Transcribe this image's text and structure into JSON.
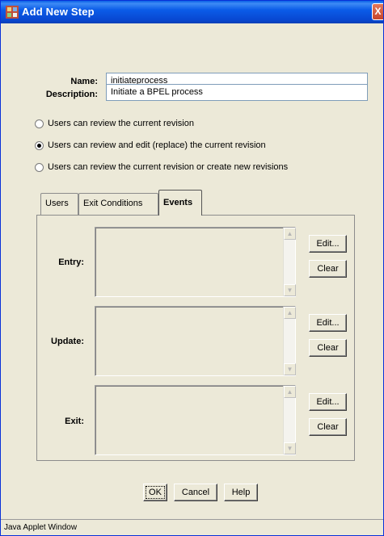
{
  "window": {
    "title": "Add New Step",
    "close_glyph": "X",
    "icon": "app-icon"
  },
  "form": {
    "name_label": "Name:",
    "name_value": "initiateprocess",
    "description_label": "Description:",
    "description_value": "Initiate a BPEL process"
  },
  "revision_options": [
    {
      "label": "Users can review the current revision",
      "selected": false
    },
    {
      "label": "Users can review and edit (replace) the current revision",
      "selected": true
    },
    {
      "label": "Users can review the current revision or create new revisions",
      "selected": false
    }
  ],
  "tabs": [
    {
      "label": "Users",
      "active": false
    },
    {
      "label": "Exit Conditions",
      "active": false
    },
    {
      "label": "Events",
      "active": true
    }
  ],
  "events": {
    "entry_label": "Entry:",
    "update_label": "Update:",
    "exit_label": "Exit:",
    "edit_label": "Edit...",
    "clear_label": "Clear"
  },
  "footer": {
    "ok_label": "OK",
    "cancel_label": "Cancel",
    "help_label": "Help"
  },
  "status": {
    "text": "Java Applet Window"
  },
  "colors": {
    "titlebar": "#0a5fe6",
    "dialog_bg": "#ece9d8",
    "field_border": "#7f9db9"
  }
}
